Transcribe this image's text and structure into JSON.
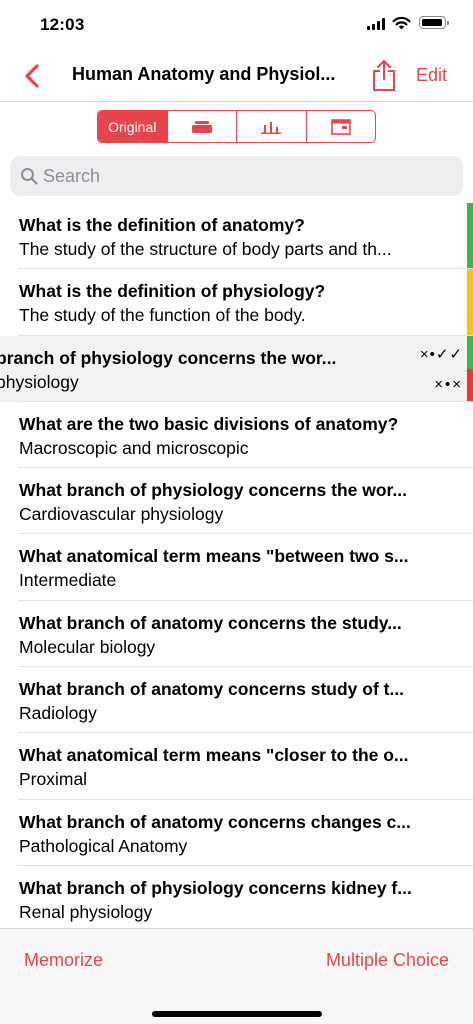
{
  "status_bar": {
    "time": "12:03"
  },
  "nav": {
    "title": "Human Anatomy and Physiol...",
    "edit_label": "Edit"
  },
  "segments": {
    "original_label": "Original",
    "selected": "Original"
  },
  "search": {
    "placeholder": "Search"
  },
  "swipe": {
    "top_marks": "×•✓✓",
    "bottom_marks": "×•×"
  },
  "rows": [
    {
      "question": "What is the definition of anatomy?",
      "answer": "The study of the structure of body parts and th...",
      "status_colors": [
        "#3fb34f",
        "#3fb34f"
      ]
    },
    {
      "question": "What is the definition of physiology?",
      "answer": "The study of the function of the body.",
      "status_colors": [
        "#f5c518",
        "#f5c518"
      ]
    },
    {
      "question": "branch of physiology concerns the wor...",
      "answer": "physiology",
      "status_colors": [
        "#3fb34f",
        "#e53935"
      ]
    },
    {
      "question": "What are the two basic divisions of anatomy?",
      "answer": "Macroscopic and microscopic"
    },
    {
      "question": "What branch of physiology concerns the wor...",
      "answer": "Cardiovascular physiology"
    },
    {
      "question": "What anatomical term means \"between two s...",
      "answer": "Intermediate"
    },
    {
      "question": "What branch of anatomy concerns the study...",
      "answer": "Molecular biology"
    },
    {
      "question": "What branch of anatomy concerns study of t...",
      "answer": "Radiology"
    },
    {
      "question": "What anatomical term means \"closer to the o...",
      "answer": "Proximal"
    },
    {
      "question": "What branch of anatomy concerns changes c...",
      "answer": "Pathological Anatomy"
    },
    {
      "question": "What branch of physiology concerns kidney f...",
      "answer": "Renal physiology"
    }
  ],
  "toolbar": {
    "memorize_label": "Memorize",
    "multiple_choice_label": "Multiple Choice"
  },
  "colors": {
    "accent": "#e5454b",
    "green": "#3fb34f",
    "yellow": "#f5c518",
    "red": "#e53935"
  }
}
